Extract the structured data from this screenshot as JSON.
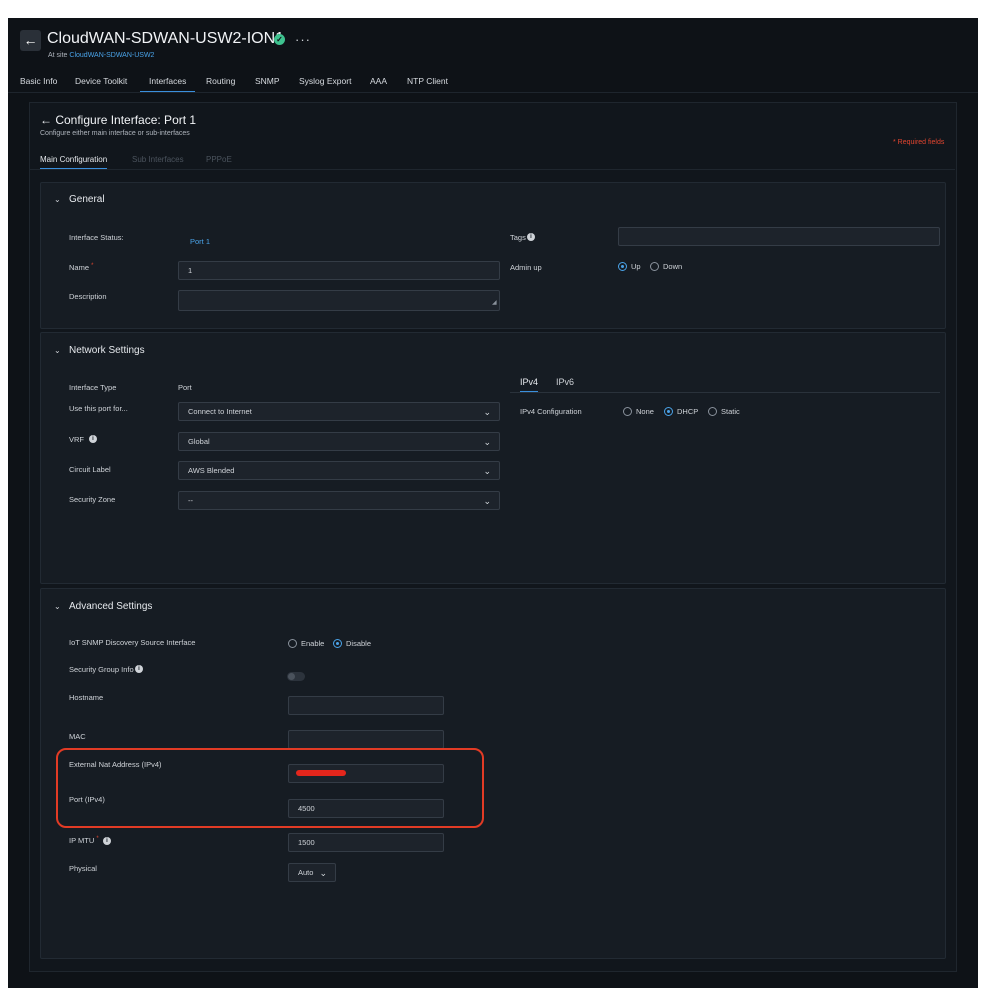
{
  "header": {
    "title": "CloudWAN-SDWAN-USW2-ION1",
    "site_prefix": "At site",
    "site_link": "CloudWAN-SDWAN-USW2",
    "back_glyph": "←",
    "more_glyph": "···",
    "verified_glyph": "✓"
  },
  "tabs": [
    {
      "label": "Basic Info"
    },
    {
      "label": "Device Toolkit"
    },
    {
      "label": "Interfaces",
      "active": true
    },
    {
      "label": "Routing"
    },
    {
      "label": "SNMP"
    },
    {
      "label": "Syslog Export"
    },
    {
      "label": "AAA"
    },
    {
      "label": "NTP Client"
    }
  ],
  "config": {
    "title": "← Configure Interface: Port 1",
    "subtitle": "Configure either main interface or sub-interfaces",
    "required_note": "* Required fields",
    "subtabs": [
      "Main Configuration",
      "Sub Interfaces",
      "PPPoE"
    ]
  },
  "general": {
    "title": "General",
    "interface_status_label": "Interface Status:",
    "interface_status_value": "Port 1",
    "tags_label": "Tags",
    "name_label": "Name",
    "required_star": "*",
    "name_value": "1",
    "admin_up_label": "Admin up",
    "admin_up_options": [
      "Up",
      "Down"
    ],
    "admin_up_selected": "Up",
    "description_label": "Description",
    "description_value": ""
  },
  "network": {
    "title": "Network Settings",
    "interface_type_label": "Interface Type",
    "interface_type_value": "Port",
    "use_port_label": "Use this port for...",
    "use_port_value": "Connect to Internet",
    "vrf_label": "VRF",
    "vrf_value": "Global",
    "circuit_label_label": "Circuit Label",
    "circuit_label_value": "AWS Blended",
    "security_zone_label": "Security Zone",
    "security_zone_value": "--",
    "ip_tabs": [
      "IPv4",
      "IPv6"
    ],
    "ipv4_config_label": "IPv4 Configuration",
    "ipv4_options": [
      "None",
      "DHCP",
      "Static"
    ],
    "ipv4_selected": "DHCP"
  },
  "advanced": {
    "title": "Advanced Settings",
    "iot_label": "IoT SNMP Discovery Source Interface",
    "iot_options": [
      "Enable",
      "Disable"
    ],
    "iot_selected": "Disable",
    "security_group_label": "Security Group Info",
    "security_group_enabled": false,
    "hostname_label": "Hostname",
    "hostname_value": "",
    "mac_label": "MAC",
    "mac_value": "",
    "ext_nat_label": "External Nat Address (IPv4)",
    "port_ipv4_label": "Port (IPv4)",
    "port_ipv4_value": "4500",
    "ip_mtu_label": "IP MTU",
    "ip_mtu_value": "1500",
    "physical_label": "Physical",
    "physical_value": "Auto"
  },
  "colors": {
    "accent": "#3a8fdc",
    "link": "#4aa3e8",
    "annotation_red": "#e23b25",
    "background": "#0e1217"
  }
}
